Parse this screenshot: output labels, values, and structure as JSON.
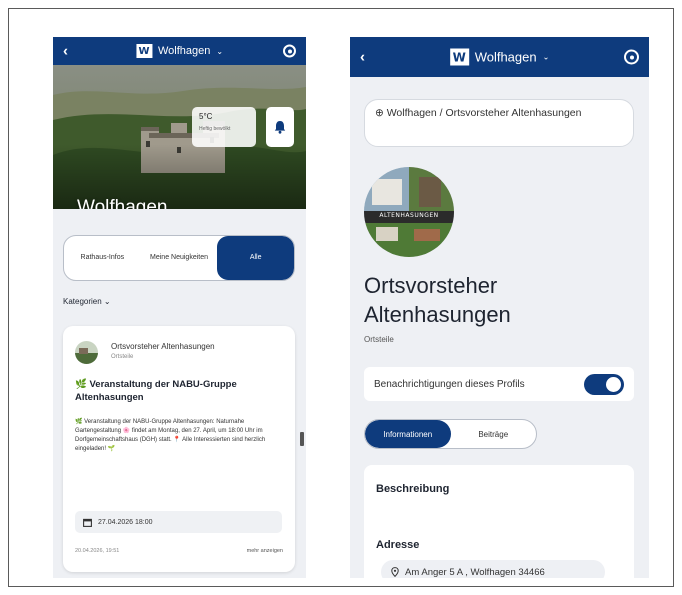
{
  "left_screen": {
    "appbar": {
      "back": "‹",
      "logo": "W",
      "title": "Wolfhagen",
      "chevron": "⌄"
    },
    "hero": {
      "title": "Wolfhagen",
      "weather": {
        "temp": "5°C",
        "desc": "Heftig bewölkt"
      }
    },
    "segments": [
      {
        "label": "Rathaus-Infos",
        "active": false
      },
      {
        "label": "Meine Neuigkeiten",
        "active": false
      },
      {
        "label": "Alle",
        "active": true
      }
    ],
    "category_filter": "Kategorien ⌄",
    "post": {
      "author": "Ortsvorsteher Altenhasungen",
      "author_sub": "Ortsteile",
      "title": "🌿 Veranstaltung der NABU-Gruppe Altenhasungen",
      "body": "🌿 Veranstaltung der NABU-Gruppe Altenhasungen: Naturnahe Gartengestaltung 🌸 findet am Montag, den 27. April, um 18:00 Uhr im Dorfgemeinschaftshaus (DGH) statt. 📍 Alle Interessierten sind herzlich eingeladen! 🌱",
      "event_date": "27.04.2026 18:00",
      "posted": "20.04.2026, 19:51",
      "more": "mehr anzeigen"
    }
  },
  "right_screen": {
    "appbar": {
      "back": "‹",
      "logo": "W",
      "title": "Wolfhagen",
      "chevron": "⌄"
    },
    "breadcrumb": "⊕ Wolfhagen / Ortsvorsteher Altenhasungen",
    "avatar_banner": "ALTENHASUNGEN",
    "profile_name": "Ortsvorsteher Altenhasungen",
    "profile_type": "Ortsteile",
    "notifications_label": "Benachrichtigungen dieses Profils",
    "notifications_on": true,
    "tabs": [
      {
        "label": "Informationen",
        "active": true
      },
      {
        "label": "Beiträge",
        "active": false
      }
    ],
    "description_heading": "Beschreibung",
    "address_heading": "Adresse",
    "address": "Am Anger 5 A , Wolfhagen 34466"
  },
  "colors": {
    "primary": "#0e3b7d",
    "background": "#eef0f4",
    "card": "#ffffff"
  },
  "icons": [
    "back-arrow-icon",
    "chevron-down-icon",
    "account-icon",
    "bell-icon",
    "calendar-icon",
    "location-pin-icon",
    "globe-icon"
  ]
}
